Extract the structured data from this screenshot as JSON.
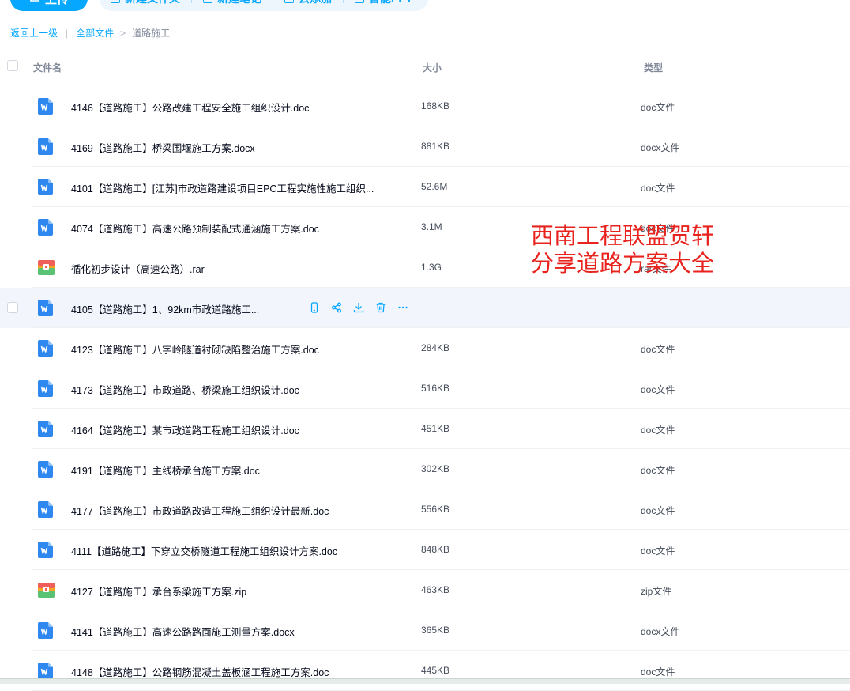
{
  "toolbar": {
    "upload": "上传",
    "new_folder": "新建文件夹",
    "new_note": "新建笔记",
    "cloud_add": "云添加",
    "smart_ppt": "智能PPT"
  },
  "breadcrumb": {
    "back": "返回上一级",
    "sep": "|",
    "all_files": "全部文件",
    "arrow": ">",
    "current": "道路施工"
  },
  "columns": {
    "name": "文件名",
    "size": "大小",
    "type": "类型"
  },
  "files": [
    {
      "name": "4146【道路施工】公路改建工程安全施工组织设计.doc",
      "size": "168KB",
      "type": "doc文件",
      "icon": "word-icon"
    },
    {
      "name": "4169【道路施工】桥梁围堰施工方案.docx",
      "size": "881KB",
      "type": "docx文件",
      "icon": "word-icon"
    },
    {
      "name": "4101【道路施工】[江苏]市政道路建设项目EPC工程实施性施工组织...",
      "size": "52.6M",
      "type": "doc文件",
      "icon": "word-icon"
    },
    {
      "name": "4074【道路施工】高速公路预制装配式通涵施工方案.doc",
      "size": "3.1M",
      "type": "doc文件",
      "icon": "word-icon"
    },
    {
      "name": "循化初步设计（高速公路）.rar",
      "size": "1.3G",
      "type": "rar文件",
      "icon": "archive-icon"
    },
    {
      "name": "4105【道路施工】1、92km市政道路施工...",
      "size": "",
      "type": "",
      "icon": "word-icon",
      "hover": true
    },
    {
      "name": "4123【道路施工】八字岭隧道衬砌缺陷整治施工方案.doc",
      "size": "284KB",
      "type": "doc文件",
      "icon": "word-icon"
    },
    {
      "name": "4173【道路施工】市政道路、桥梁施工组织设计.doc",
      "size": "516KB",
      "type": "doc文件",
      "icon": "word-icon"
    },
    {
      "name": "4164【道路施工】某市政道路工程施工组织设计.doc",
      "size": "451KB",
      "type": "doc文件",
      "icon": "word-icon"
    },
    {
      "name": "4191【道路施工】主线桥承台施工方案.doc",
      "size": "302KB",
      "type": "doc文件",
      "icon": "word-icon"
    },
    {
      "name": "4177【道路施工】市政道路改造工程施工组织设计最新.doc",
      "size": "556KB",
      "type": "doc文件",
      "icon": "word-icon"
    },
    {
      "name": "4111【道路施工】下穿立交桥隧道工程施工组织设计方案.doc",
      "size": "848KB",
      "type": "doc文件",
      "icon": "word-icon"
    },
    {
      "name": "4127【道路施工】承台系梁施工方案.zip",
      "size": "463KB",
      "type": "zip文件",
      "icon": "archive-icon"
    },
    {
      "name": "4141【道路施工】高速公路路面施工测量方案.docx",
      "size": "365KB",
      "type": "docx文件",
      "icon": "word-icon"
    },
    {
      "name": "4148【道路施工】公路钢筋混凝土盖板涵工程施工方案.doc",
      "size": "445KB",
      "type": "doc文件",
      "icon": "word-icon"
    }
  ],
  "watermark": {
    "line1": "西南工程联盟贺轩",
    "line2": "分享道路方案大全"
  },
  "colors": {
    "accent": "#06a7ff",
    "word": "#2e88f0",
    "watermark": "#e8221d"
  }
}
